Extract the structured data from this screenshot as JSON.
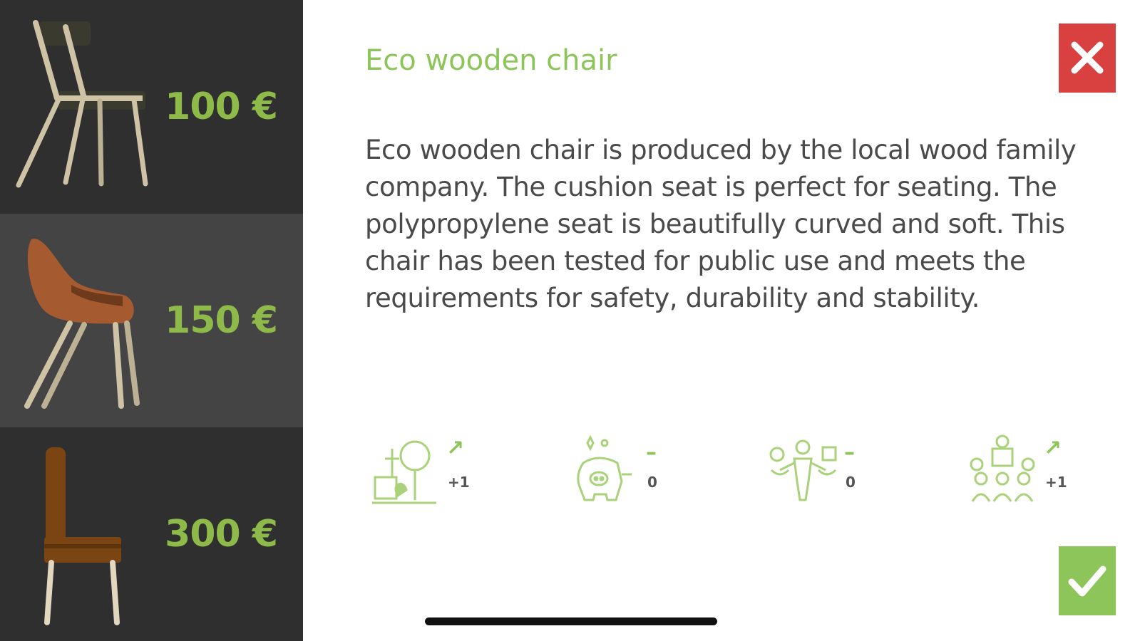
{
  "options": [
    {
      "price": "100 €",
      "icon": "wooden-chair-icon"
    },
    {
      "price": "150 €",
      "icon": "upholstered-chair-icon"
    },
    {
      "price": "300 €",
      "icon": "brown-chair-icon"
    }
  ],
  "selected_option_index": 1,
  "detail": {
    "title": "Eco wooden chair",
    "description": "Eco wooden chair is produced by the local wood family company. The cushion seat is perfect for seating. The polypropylene seat is beautifully curved and soft. This chair has been tested for public use and meets the requirements for safety, durability and stability."
  },
  "impacts": [
    {
      "icon": "environment-icon",
      "indicator": "↗",
      "delta": "+1"
    },
    {
      "icon": "piggy-bank-icon",
      "indicator": "–",
      "delta": "0"
    },
    {
      "icon": "balance-person-icon",
      "indicator": "–",
      "delta": "0"
    },
    {
      "icon": "community-icon",
      "indicator": "↗",
      "delta": "+1"
    }
  ],
  "colors": {
    "sidebar": "#2f2f2f",
    "sidebar_selected": "#444444",
    "accent_green": "#8dc55a",
    "close_red": "#d84140"
  }
}
